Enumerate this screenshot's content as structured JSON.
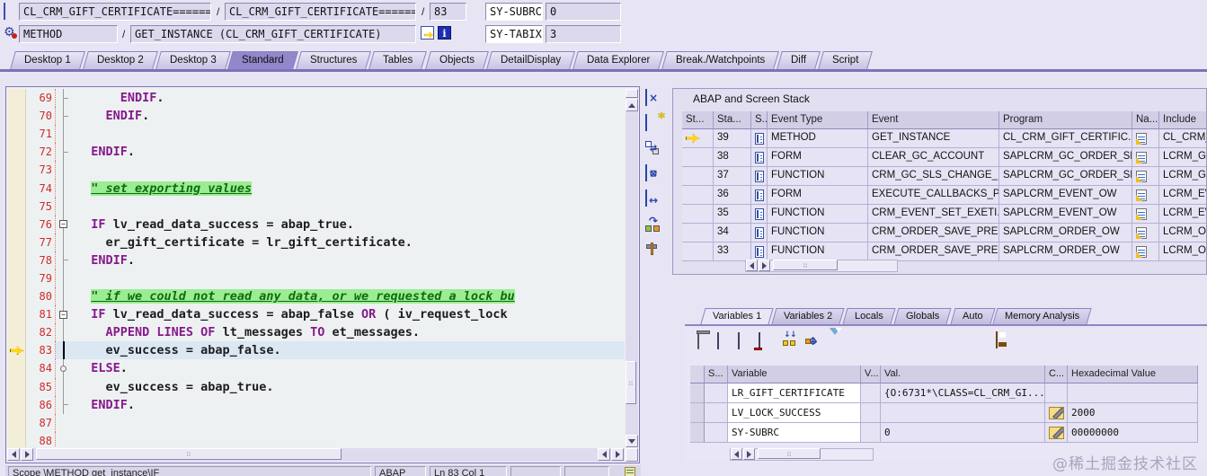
{
  "toolbar": {
    "separator": "/",
    "stack_field_1": "CL_CRM_GIFT_CERTIFICATE======...",
    "stack_field_2": "CL_CRM_GIFT_CERTIFICATE======...",
    "line_field": "83",
    "sy_subrc_label": "SY-SUBRC",
    "sy_subrc_value": "0",
    "event_type_field": "METHOD",
    "event_field": "GET_INSTANCE (CL_CRM_GIFT_CERTIFICATE)",
    "sy_tabix_label": "SY-TABIX",
    "sy_tabix_value": "3"
  },
  "desktop_tabs": [
    "Desktop 1",
    "Desktop 2",
    "Desktop 3",
    "Standard",
    "Structures",
    "Tables",
    "Objects",
    "DetailDisplay",
    "Data Explorer",
    "Break./Watchpoints",
    "Diff",
    "Script"
  ],
  "desktop_tabs_active": "Standard",
  "icons": {
    "close": "×",
    "new_window_star": "*",
    "swap": "⇄",
    "arrows_h": "↔",
    "arrows_v": "↕",
    "redo": "↷",
    "info": "i",
    "fold_minus": "−",
    "grip": "∷"
  },
  "editor": {
    "lines": [
      {
        "num": "69",
        "fold": "tick",
        "guide": true,
        "current": false,
        "segments": [
          {
            "c": "tx",
            "t": "      "
          },
          {
            "c": "kw",
            "t": "ENDIF"
          },
          {
            "c": "tx",
            "t": "."
          }
        ]
      },
      {
        "num": "70",
        "fold": "tick",
        "guide": true,
        "current": false,
        "segments": [
          {
            "c": "tx",
            "t": "    "
          },
          {
            "c": "kw",
            "t": "ENDIF"
          },
          {
            "c": "tx",
            "t": "."
          }
        ]
      },
      {
        "num": "71",
        "fold": "",
        "guide": true,
        "current": false,
        "segments": []
      },
      {
        "num": "72",
        "fold": "tick",
        "guide": true,
        "current": false,
        "segments": [
          {
            "c": "tx",
            "t": "  "
          },
          {
            "c": "kw",
            "t": "ENDIF"
          },
          {
            "c": "tx",
            "t": "."
          }
        ]
      },
      {
        "num": "73",
        "fold": "",
        "guide": true,
        "current": false,
        "segments": []
      },
      {
        "num": "74",
        "fold": "",
        "guide": true,
        "current": false,
        "segments": [
          {
            "c": "tx",
            "t": "  "
          },
          {
            "c": "cm",
            "t": "\" set exporting values"
          }
        ]
      },
      {
        "num": "75",
        "fold": "",
        "guide": true,
        "current": false,
        "segments": []
      },
      {
        "num": "76",
        "fold": "box",
        "guide": true,
        "current": false,
        "segments": [
          {
            "c": "tx",
            "t": "  "
          },
          {
            "c": "kw",
            "t": "IF"
          },
          {
            "c": "tx",
            "t": " lv_read_data_success = abap_true."
          }
        ]
      },
      {
        "num": "77",
        "fold": "",
        "guide": true,
        "current": false,
        "segments": [
          {
            "c": "tx",
            "t": "    er_gift_certificate = lr_gift_certificate."
          }
        ]
      },
      {
        "num": "78",
        "fold": "tick",
        "guide": true,
        "current": false,
        "segments": [
          {
            "c": "tx",
            "t": "  "
          },
          {
            "c": "kw",
            "t": "ENDIF"
          },
          {
            "c": "tx",
            "t": "."
          }
        ]
      },
      {
        "num": "79",
        "fold": "",
        "guide": true,
        "current": false,
        "segments": []
      },
      {
        "num": "80",
        "fold": "",
        "guide": true,
        "current": false,
        "segments": [
          {
            "c": "tx",
            "t": "  "
          },
          {
            "c": "cm",
            "t": "\" if we could not read any data, or we requested a lock bu"
          }
        ]
      },
      {
        "num": "81",
        "fold": "box",
        "guide": true,
        "current": false,
        "segments": [
          {
            "c": "tx",
            "t": "  "
          },
          {
            "c": "kw",
            "t": "IF"
          },
          {
            "c": "tx",
            "t": " lv_read_data_success = abap_false "
          },
          {
            "c": "kw",
            "t": "OR"
          },
          {
            "c": "tx",
            "t": " ( iv_request_lock"
          }
        ]
      },
      {
        "num": "82",
        "fold": "",
        "guide": true,
        "current": false,
        "segments": [
          {
            "c": "tx",
            "t": "    "
          },
          {
            "c": "kw",
            "t": "APPEND LINES OF"
          },
          {
            "c": "tx",
            "t": " lt_messages "
          },
          {
            "c": "kw",
            "t": "TO"
          },
          {
            "c": "tx",
            "t": " et_messages."
          }
        ]
      },
      {
        "num": "83",
        "fold": "",
        "guide": true,
        "current": true,
        "segments": [
          {
            "c": "tx",
            "t": "    ev_success = abap_false."
          }
        ]
      },
      {
        "num": "84",
        "fold": "circle",
        "guide": true,
        "current": false,
        "segments": [
          {
            "c": "tx",
            "t": "  "
          },
          {
            "c": "kw",
            "t": "ELSE"
          },
          {
            "c": "tx",
            "t": "."
          }
        ]
      },
      {
        "num": "85",
        "fold": "",
        "guide": true,
        "current": false,
        "segments": [
          {
            "c": "tx",
            "t": "    ev_success = abap_true."
          }
        ]
      },
      {
        "num": "86",
        "fold": "tick",
        "guide": true,
        "current": false,
        "segments": [
          {
            "c": "tx",
            "t": "  "
          },
          {
            "c": "kw",
            "t": "ENDIF"
          },
          {
            "c": "tx",
            "t": "."
          }
        ]
      },
      {
        "num": "87",
        "fold": "",
        "guide": false,
        "current": false,
        "segments": []
      },
      {
        "num": "88",
        "fold": "",
        "guide": false,
        "current": false,
        "segments": []
      }
    ],
    "status_scope": "Scope \\METHOD get_instance\\IF",
    "status_lang": "ABAP",
    "status_pos": "Ln 83 Col 1"
  },
  "stack": {
    "title": "ABAP and Screen Stack",
    "columns": [
      "St...",
      "Sta...",
      "S..",
      "Event Type",
      "Event",
      "Program",
      "Na...",
      "Include"
    ],
    "rows": [
      {
        "current": true,
        "step": "39",
        "event_type": "METHOD",
        "event": "GET_INSTANCE",
        "program": "CL_CRM_GIFT_CERTIFIC...",
        "include": "CL_CRM_G"
      },
      {
        "current": false,
        "step": "38",
        "event_type": "FORM",
        "event": "CLEAR_GC_ACCOUNT",
        "program": "SAPLCRM_GC_ORDER_SL...",
        "include": "LCRM_GC_"
      },
      {
        "current": false,
        "step": "37",
        "event_type": "FUNCTION",
        "event": "CRM_GC_SLS_CHANGE_...",
        "program": "SAPLCRM_GC_ORDER_SL...",
        "include": "LCRM_GC_"
      },
      {
        "current": false,
        "step": "36",
        "event_type": "FORM",
        "event": "EXECUTE_CALLBACKS_P...",
        "program": "SAPLCRM_EVENT_OW",
        "include": "LCRM_EVE"
      },
      {
        "current": false,
        "step": "35",
        "event_type": "FUNCTION",
        "event": "CRM_EVENT_SET_EXETI...",
        "program": "SAPLCRM_EVENT_OW",
        "include": "LCRM_EVE"
      },
      {
        "current": false,
        "step": "34",
        "event_type": "FUNCTION",
        "event": "CRM_ORDER_SAVE_PRE...",
        "program": "SAPLCRM_ORDER_OW",
        "include": "LCRM_ORD"
      },
      {
        "current": false,
        "step": "33",
        "event_type": "FUNCTION",
        "event": "CRM_ORDER_SAVE_PRE...",
        "program": "SAPLCRM_ORDER_OW",
        "include": "LCRM_ORD"
      }
    ]
  },
  "variables_panel": {
    "tabs": [
      "Variables 1",
      "Variables 2",
      "Locals",
      "Globals",
      "Auto",
      "Memory Analysis"
    ],
    "active_tab": "Variables 1",
    "columns": [
      "S...",
      "Variable",
      "V...",
      "Val.",
      "C...",
      "Hexadecimal Value"
    ],
    "rows": [
      {
        "variable": "LR_GIFT_CERTIFICATE",
        "val": "{O:6731*\\CLASS=CL_CRM_GI...",
        "pencil": false,
        "hex": ""
      },
      {
        "variable": "LV_LOCK_SUCCESS",
        "val": "",
        "pencil": true,
        "hex": "2000"
      },
      {
        "variable": "SY-SUBRC",
        "val": "0",
        "pencil": true,
        "hex": "00000000"
      }
    ]
  },
  "watermark": "@稀土掘金技术社区"
}
